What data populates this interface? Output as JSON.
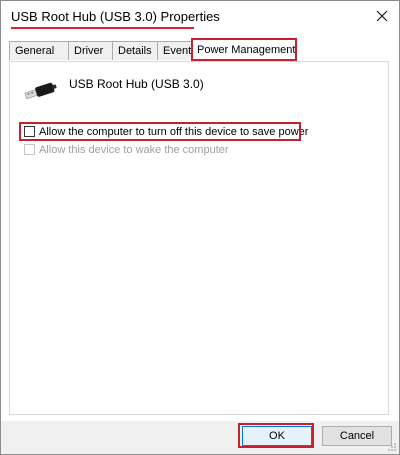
{
  "window": {
    "title": "USB Root Hub (USB 3.0) Properties"
  },
  "tabs": [
    {
      "label": "General"
    },
    {
      "label": "Driver"
    },
    {
      "label": "Details"
    },
    {
      "label": "Events"
    },
    {
      "label": "Power Management",
      "active": true
    }
  ],
  "device": {
    "name": "USB Root Hub (USB 3.0)",
    "icon": "usb-connector-icon"
  },
  "options": [
    {
      "label": "Allow the computer to turn off this device to save power",
      "checked": false,
      "enabled": true
    },
    {
      "label": "Allow this device to wake the computer",
      "checked": false,
      "enabled": false
    }
  ],
  "buttons": {
    "ok": "OK",
    "cancel": "Cancel"
  },
  "colors": {
    "highlight": "#c8202e",
    "ok_border": "#0078d7"
  }
}
